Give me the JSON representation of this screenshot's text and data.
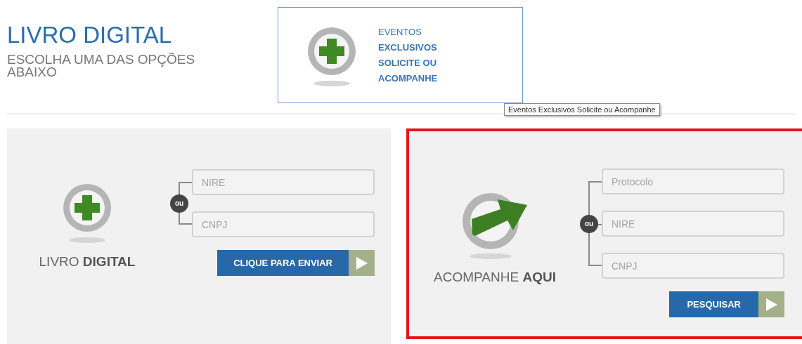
{
  "header": {
    "title": "LIVRO DIGITAL",
    "subtitle": "ESCOLHA UMA DAS OPÇÕES ABAIXO"
  },
  "event_card": {
    "lines": [
      "EVENTOS",
      "EXCLUSIVOS",
      "SOLICITE OU",
      "ACOMPANHE"
    ]
  },
  "tooltip": "Eventos Exclusivos Solicite ou Acompanhe",
  "panels": [
    {
      "kind": "plus",
      "title": "LIVRO **DIGITAL**",
      "highlighted": false,
      "separator": "ou",
      "fields": [
        {
          "placeholder": "NIRE"
        },
        {
          "placeholder": "CNPJ"
        }
      ],
      "button": "CLIQUE PARA ENVIAR"
    },
    {
      "kind": "arrow",
      "title": "ACOMPANHE **AQUI**",
      "highlighted": true,
      "separator": "ou",
      "fields": [
        {
          "placeholder": "Protocolo"
        },
        {
          "placeholder": "NIRE"
        },
        {
          "placeholder": "CNPJ"
        }
      ],
      "button": "PESQUISAR"
    }
  ]
}
